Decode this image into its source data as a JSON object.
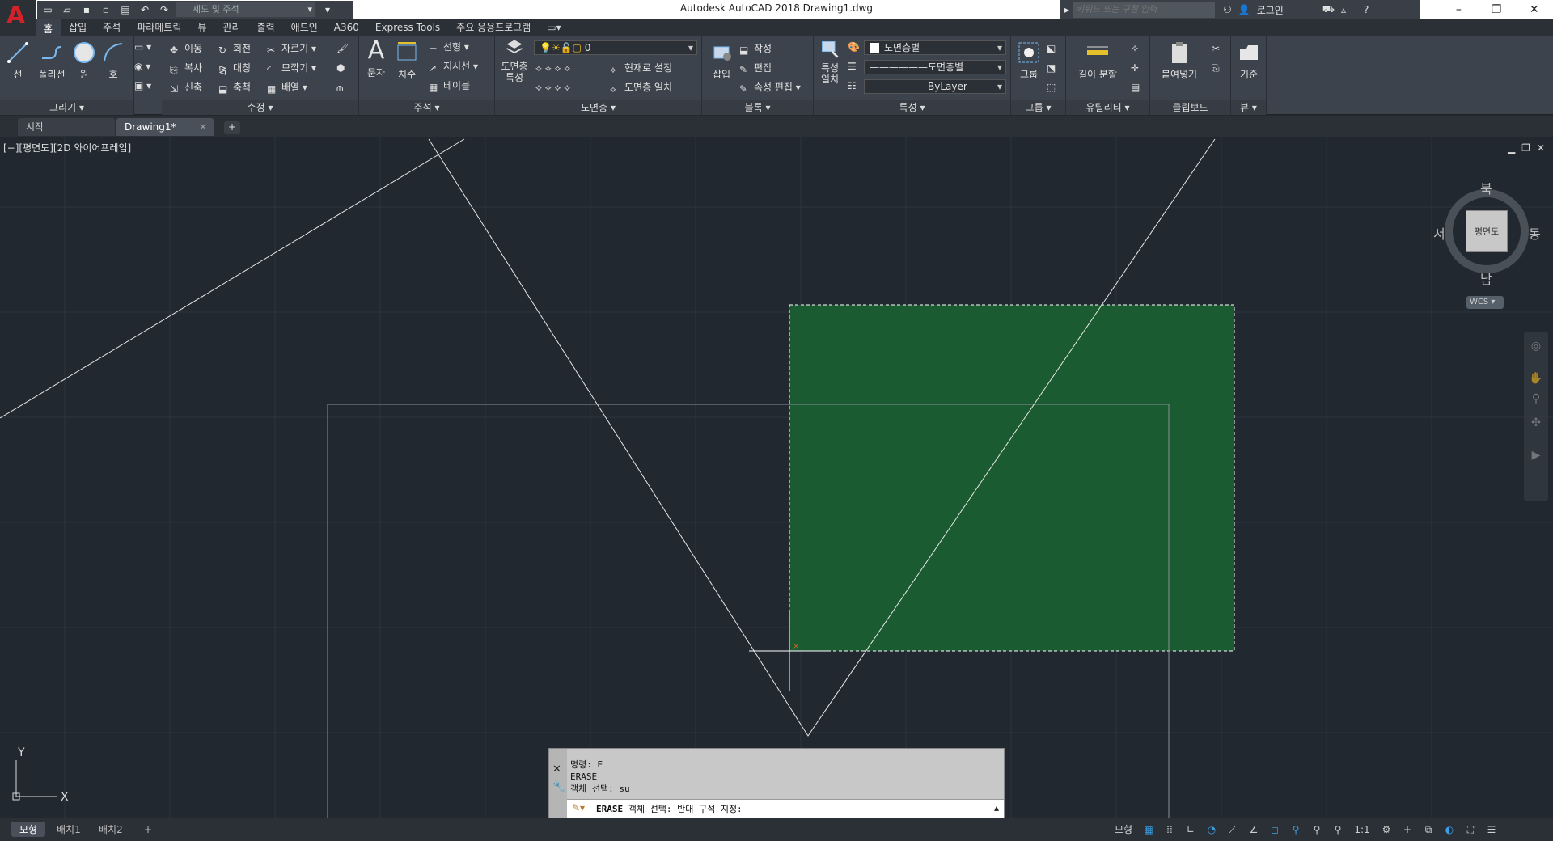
{
  "app": {
    "logo_letter": "A",
    "window_title": "Autodesk AutoCAD 2018    Drawing1.dwg",
    "workspace": "제도 및 주석",
    "search_placeholder": "키워드 또는 구절 입력",
    "login_label": "로그인",
    "help_label": "?"
  },
  "ribbon_tabs": [
    "홈",
    "삽입",
    "주석",
    "파라메트릭",
    "뷰",
    "관리",
    "출력",
    "애드인",
    "A360",
    "Express Tools",
    "주요 응용프로그램"
  ],
  "ribbon": {
    "draw": {
      "title": "그리기",
      "line": "선",
      "polyline": "폴리선",
      "circle": "원",
      "arc": "호"
    },
    "modify": {
      "title": "수정",
      "move": "이동",
      "rotate": "회전",
      "trim": "자르기",
      "copy": "복사",
      "mirror": "대칭",
      "fillet": "모깎기",
      "stretch": "신축",
      "scale": "축척",
      "array": "배열"
    },
    "annotation": {
      "title": "주석",
      "text": "문자",
      "dimension": "치수",
      "linear": "선형",
      "leader": "지시선",
      "table": "테이블"
    },
    "layers": {
      "title": "도면층",
      "properties_line1": "도면층",
      "properties_line2": "특성",
      "current_layer": "0",
      "make_current": "현재로 설정",
      "match_layer": "도면층 일치"
    },
    "block": {
      "title": "블록",
      "insert": "삽입",
      "create": "작성",
      "edit": "편집",
      "edit_attributes": "속성 편집"
    },
    "properties": {
      "title": "특성",
      "match_line1": "특성",
      "match_line2": "일치",
      "color": "도면층별",
      "linetype": "도면층별",
      "lineweight": "ByLayer"
    },
    "groups": {
      "title": "그룹",
      "group": "그룹"
    },
    "utilities": {
      "title": "유틸리티",
      "measure": "길이 분할"
    },
    "clipboard": {
      "title": "클립보드",
      "paste": "붙여넣기"
    },
    "view": {
      "title": "뷰",
      "base": "기준"
    }
  },
  "file_tabs": {
    "start": "시작",
    "drawing": "Drawing1*"
  },
  "viewport": {
    "label": "[−][평면도][2D 와이어프레임]",
    "viewcube": {
      "face": "평면도",
      "north": "북",
      "south": "남",
      "east": "동",
      "west": "서",
      "wcs": "WCS"
    },
    "ucs": {
      "x": "X",
      "y": "Y"
    }
  },
  "command": {
    "history": [
      "명령: E",
      "ERASE",
      "객체 선택: su"
    ],
    "prompt_cmd": "ERASE",
    "prompt_text": "객체 선택: 반대 구석 지정:"
  },
  "layout_tabs": [
    "모형",
    "배치1",
    "배치2"
  ],
  "status": {
    "model": "모형",
    "scale": "1:1"
  },
  "colors": {
    "selection_fill": "#1b5e31",
    "canvas_bg": "#212830",
    "logo_red": "#d2232a"
  }
}
